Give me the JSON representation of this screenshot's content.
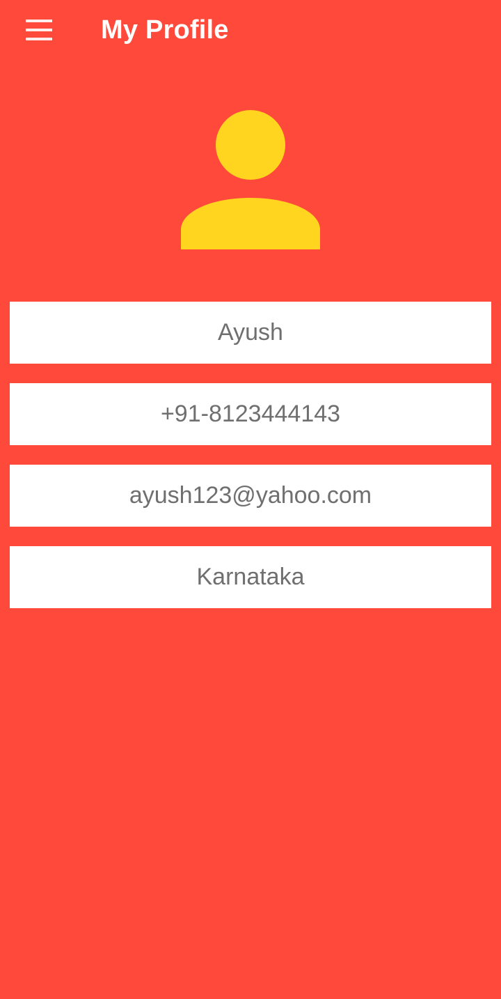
{
  "header": {
    "title": "My Profile",
    "menu_icon": "hamburger-menu-icon"
  },
  "avatar": {
    "icon": "person-icon",
    "color": "#FFD51F"
  },
  "profile": {
    "name": "Ayush",
    "phone": "+91-8123444143",
    "email": "ayush123@yahoo.com",
    "state": "Karnataka"
  },
  "colors": {
    "background": "#FF4A3B",
    "field_background": "#FFFFFF",
    "field_text": "#6F6F6F",
    "title_text": "#FFFFFF"
  }
}
